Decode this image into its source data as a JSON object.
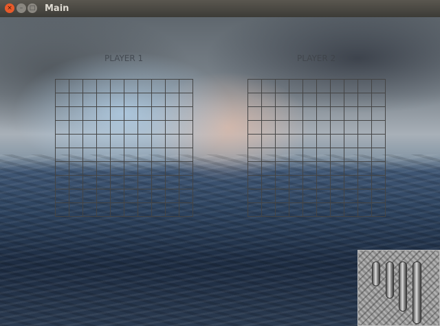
{
  "window": {
    "title": "Main",
    "close_icon": "×",
    "minimize_icon": "–",
    "maximize_icon": "□"
  },
  "players": [
    {
      "label": "PLAYER 1"
    },
    {
      "label": "PLAYER 2"
    }
  ],
  "board": {
    "rows": 10,
    "cols": 10
  },
  "ships": [
    {
      "name": "ship-2",
      "length": 2
    },
    {
      "name": "ship-3",
      "length": 3
    },
    {
      "name": "ship-4",
      "length": 4
    },
    {
      "name": "ship-5",
      "length": 5
    }
  ]
}
